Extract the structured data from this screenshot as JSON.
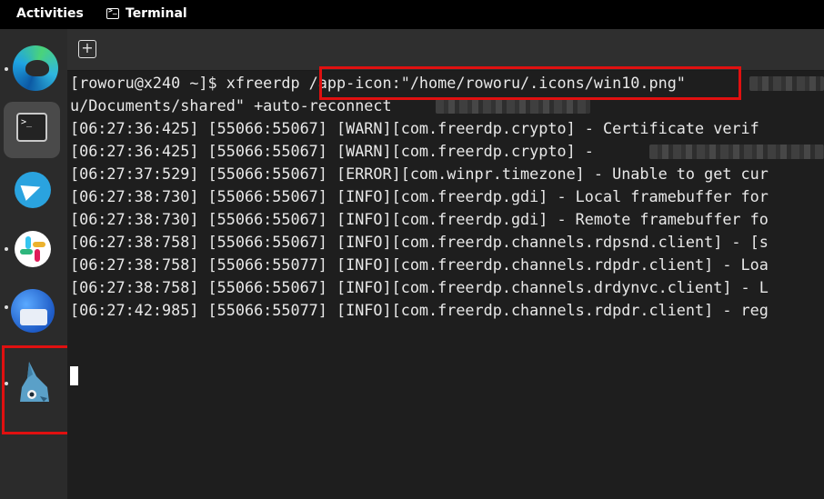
{
  "topbar": {
    "activities": "Activities",
    "app_name": "Terminal",
    "app_icon": "terminal-icon"
  },
  "dock": {
    "items": [
      {
        "name": "Microsoft Edge",
        "icon": "edge-icon"
      },
      {
        "name": "Terminal",
        "icon": "terminal-icon",
        "active": true
      },
      {
        "name": "Telegram",
        "icon": "telegram-icon"
      },
      {
        "name": "Slack",
        "icon": "slack-icon"
      },
      {
        "name": "Thunderbird",
        "icon": "thunderbird-icon"
      },
      {
        "name": "Remmina",
        "icon": "remmina-icon",
        "highlighted": true
      }
    ]
  },
  "terminal": {
    "new_tab_icon": "plus-icon",
    "lines": [
      "[roworu@x240 ~]$ xfreerdp /app-icon:\"/home/roworu/.icons/win10.png\"",
      "u/Documents/shared\" +auto-reconnect",
      "[06:27:36:425] [55066:55067] [WARN][com.freerdp.crypto] - Certificate verif",
      "[06:27:36:425] [55066:55067] [WARN][com.freerdp.crypto] -",
      "[06:27:37:529] [55066:55067] [ERROR][com.winpr.timezone] - Unable to get cur",
      "[06:27:38:730] [55066:55067] [INFO][com.freerdp.gdi] - Local framebuffer for",
      "[06:27:38:730] [55066:55067] [INFO][com.freerdp.gdi] - Remote framebuffer fo",
      "[06:27:38:758] [55066:55067] [INFO][com.freerdp.channels.rdpsnd.client] - [s",
      "[06:27:38:758] [55066:55077] [INFO][com.freerdp.channels.rdpdr.client] - Loa",
      "[06:27:38:758] [55066:55067] [INFO][com.freerdp.channels.drdynvc.client] - L",
      "[06:27:42:985] [55066:55077] [INFO][com.freerdp.channels.rdpdr.client] - reg"
    ]
  },
  "colors": {
    "highlight": "#e01010",
    "terminal_bg": "#1e1e1e",
    "dock_bg": "#2b2b2b",
    "topbar_bg": "#000000"
  }
}
